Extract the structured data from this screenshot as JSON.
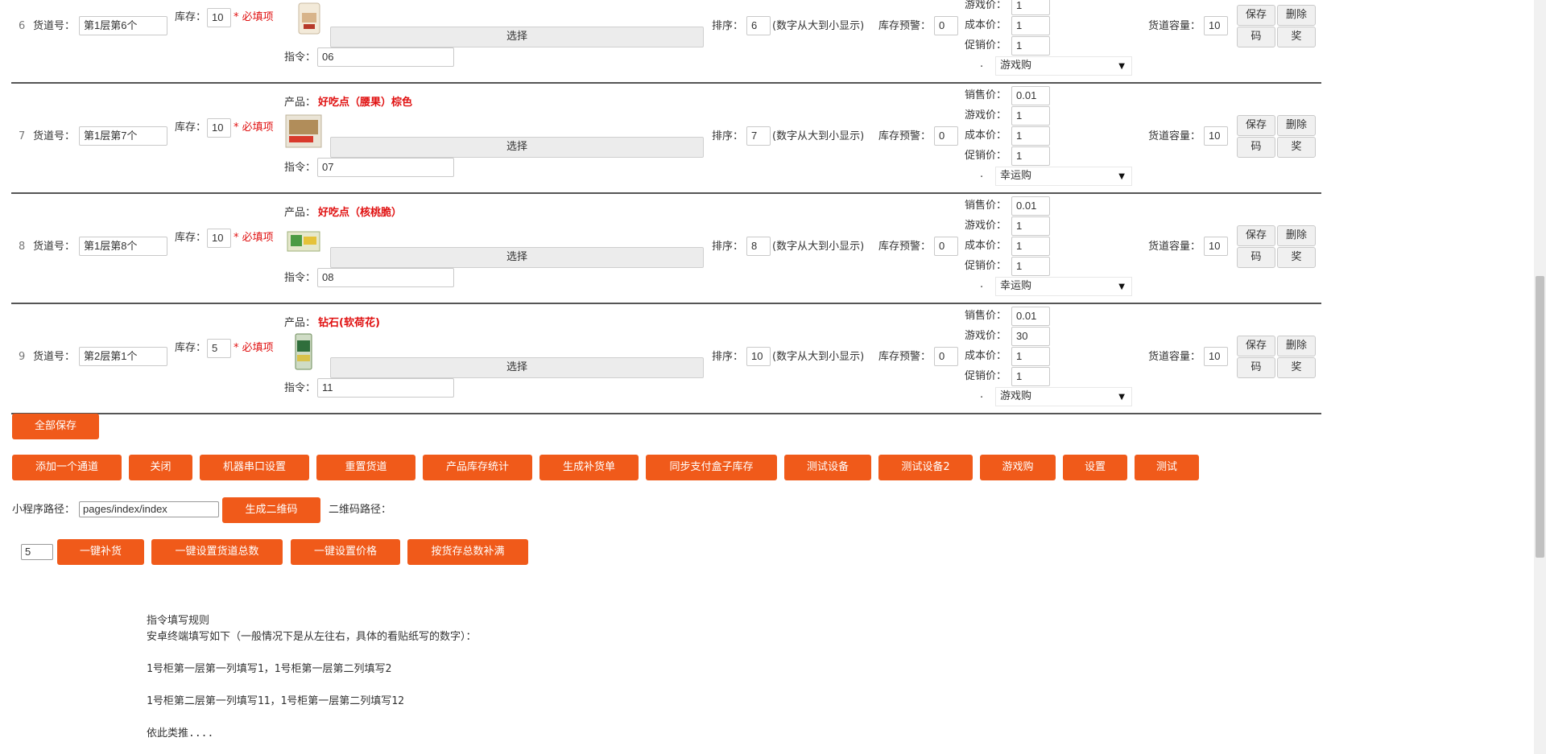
{
  "labels": {
    "lane_no": "货道号：",
    "stock": "库存：",
    "required": "* 必填项",
    "product": "产品：",
    "choose": "选择",
    "command": "指令：",
    "sort": "排序：",
    "sort_hint": "(数字从大到小显示)",
    "stock_warning": "库存预警：",
    "sale_price": "销售价：",
    "game_price": "游戏价：",
    "cost_price": "成本价：",
    "promo_price": "促销价：",
    "dot": ".",
    "capacity": "货道容量：",
    "save": "保存",
    "delete": "删除",
    "code": "码",
    "prize": "奖"
  },
  "rows": [
    {
      "index": "6",
      "lane": "第1层第6个",
      "stock": "10",
      "product": "",
      "command": "06",
      "sort": "6",
      "warning": "0",
      "sale": "",
      "game": "1",
      "cost": "1",
      "promo": "1",
      "mode": "游戏购",
      "capacity": "10"
    },
    {
      "index": "7",
      "lane": "第1层第7个",
      "stock": "10",
      "product": "好吃点（腰果）棕色",
      "command": "07",
      "sort": "7",
      "warning": "0",
      "sale": "0.01",
      "game": "1",
      "cost": "1",
      "promo": "1",
      "mode": "幸运购",
      "capacity": "10"
    },
    {
      "index": "8",
      "lane": "第1层第8个",
      "stock": "10",
      "product": "好吃点（核桃脆）",
      "command": "08",
      "sort": "8",
      "warning": "0",
      "sale": "0.01",
      "game": "1",
      "cost": "1",
      "promo": "1",
      "mode": "幸运购",
      "capacity": "10"
    },
    {
      "index": "9",
      "lane": "第2层第1个",
      "stock": "5",
      "product": "钻石(软荷花)",
      "command": "11",
      "sort": "10",
      "warning": "0",
      "sale": "0.01",
      "game": "30",
      "cost": "1",
      "promo": "1",
      "mode": "游戏购",
      "capacity": "10"
    }
  ],
  "save_all": "全部保存",
  "toolbar": [
    "添加一个通道",
    "关闭",
    "机器串口设置",
    "重置货道",
    "产品库存统计",
    "生成补货单",
    "同步支付盒子库存",
    "测试设备",
    "测试设备2",
    "游戏购",
    "设置",
    "测试"
  ],
  "mini_program": {
    "label": "小程序路径：",
    "value": "pages/index/index",
    "generate": "生成二维码",
    "qr_label": "二维码路径："
  },
  "bulk": {
    "value": "5",
    "buttons": [
      "一键补货",
      "一键设置货道总数",
      "一键设置价格",
      "按货存总数补满"
    ]
  },
  "rules": [
    "指令填写规则",
    "安卓终端填写如下（一般情况下是从左往右，具体的看贴纸写的数字）：",
    "1号柜第一层第一列填写1，1号柜第一层第二列填写2",
    "1号柜第二层第一列填写11，1号柜第一层第二列填写12",
    "依此类推...."
  ]
}
